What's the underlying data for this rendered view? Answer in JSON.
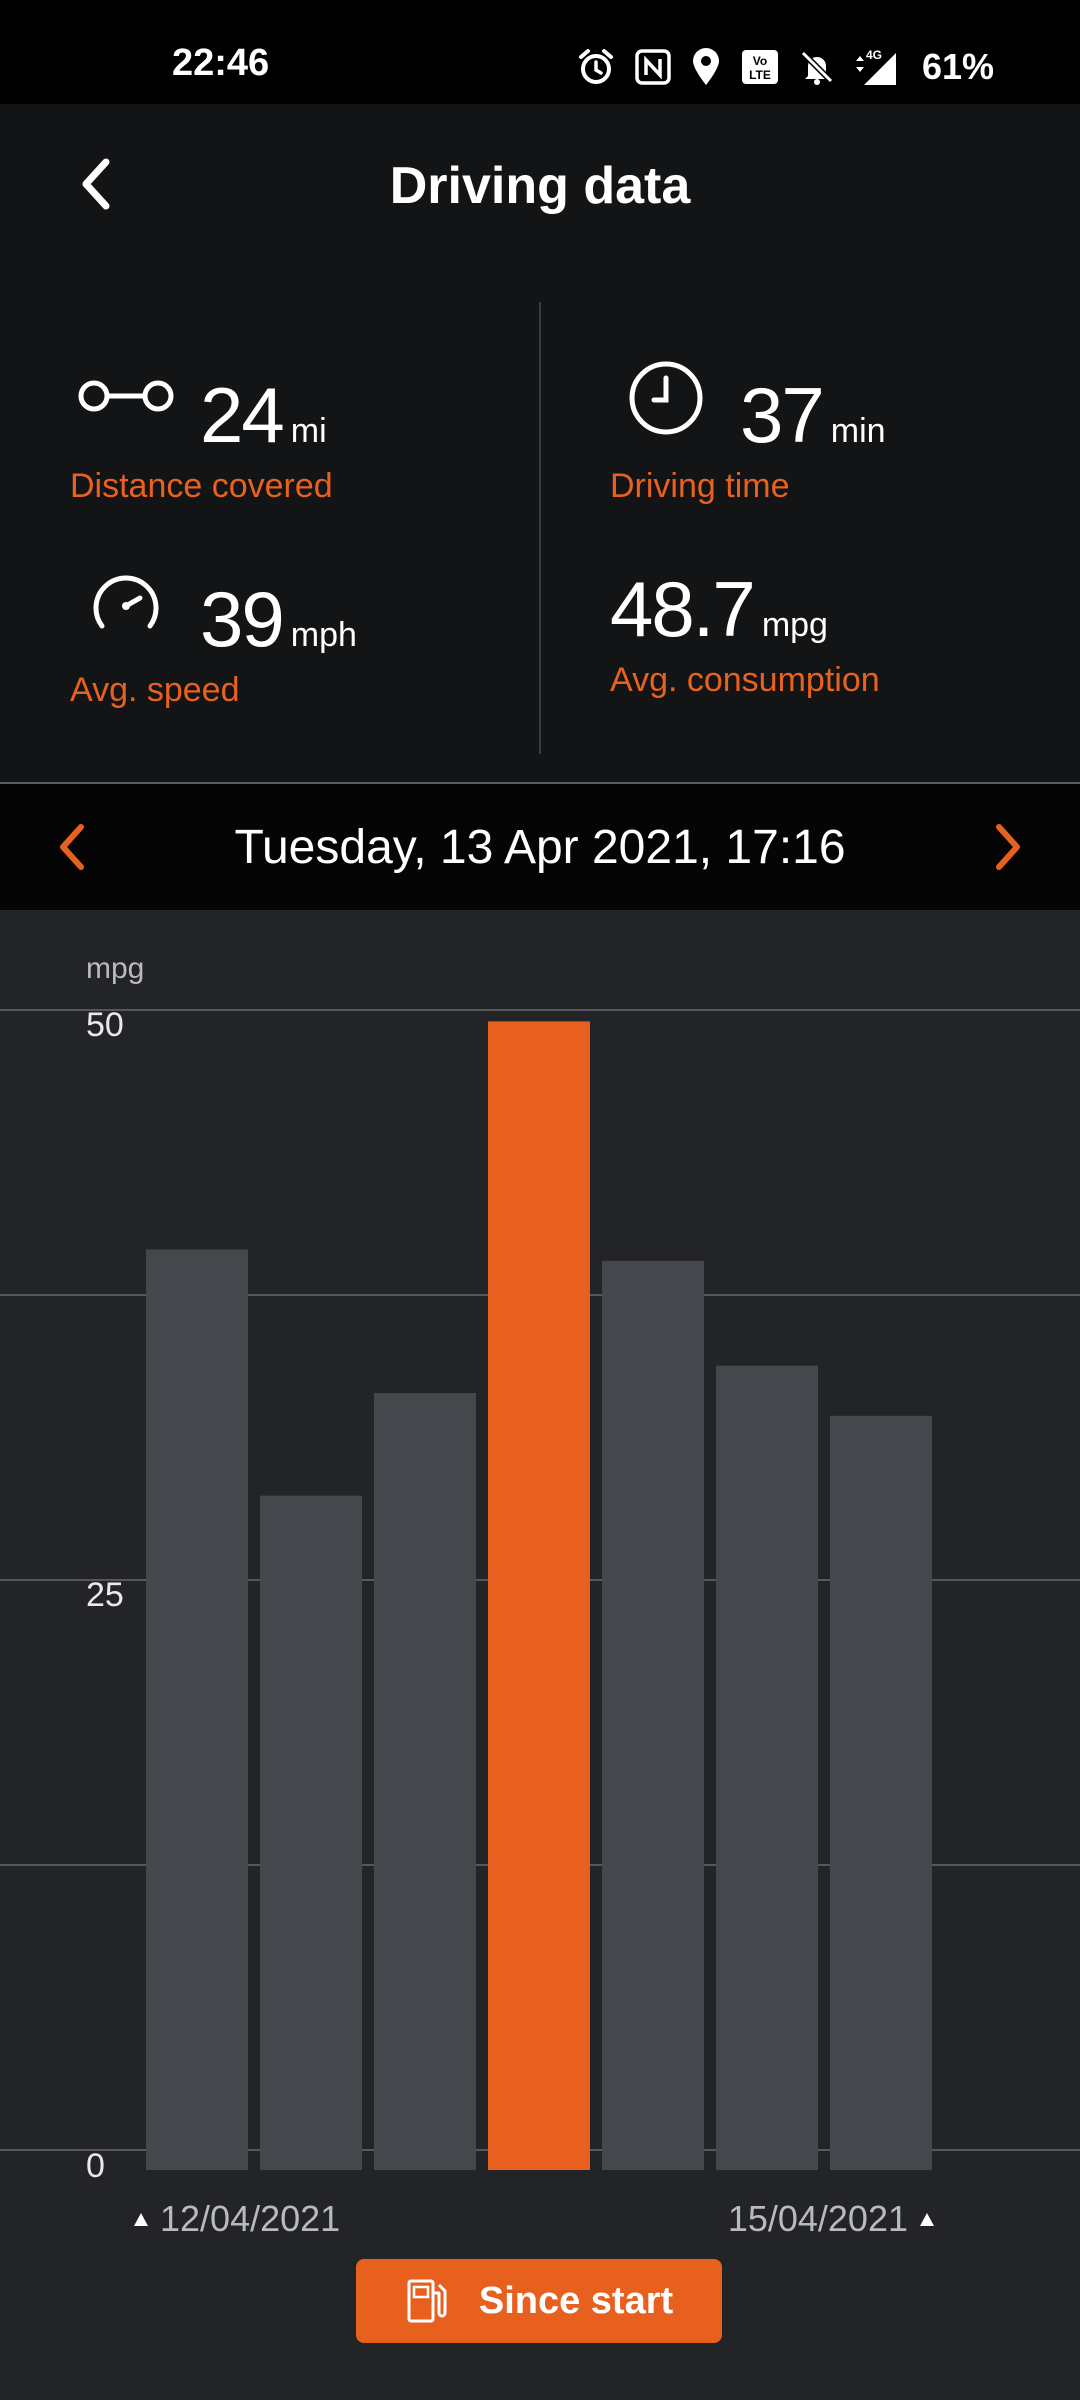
{
  "status_bar": {
    "time": "22:46",
    "battery": "61%",
    "icons": [
      "alarm-icon",
      "nfc-icon",
      "location-icon",
      "volte-icon",
      "bell-off-icon",
      "signal-4g-icon"
    ]
  },
  "header": {
    "title": "Driving data",
    "back_icon": "chevron-left-icon"
  },
  "stats": {
    "distance": {
      "value": "24",
      "unit": "mi",
      "label": "Distance covered",
      "icon": "distance-icon"
    },
    "driving_time": {
      "value": "37",
      "unit": "min",
      "label": "Driving time",
      "icon": "clock-icon"
    },
    "avg_speed": {
      "value": "39",
      "unit": "mph",
      "label": "Avg. speed",
      "icon": "speedometer-icon"
    },
    "avg_consumption": {
      "value": "48.7",
      "unit": "mpg",
      "label": "Avg. consumption"
    }
  },
  "date_nav": {
    "label": "Tuesday, 13 Apr 2021, 17:16",
    "prev_icon": "chevron-left-icon",
    "next_icon": "chevron-right-icon"
  },
  "chart": {
    "unit_label": "mpg",
    "start_date": "12/04/2021",
    "end_date": "15/04/2021"
  },
  "chart_data": {
    "type": "bar",
    "ylabel": "mpg",
    "ylim": [
      0,
      50
    ],
    "yticks": [
      "50",
      "25",
      "0"
    ],
    "values": [
      39.5,
      28.7,
      33.2,
      49.5,
      39.0,
      34.4,
      32.2
    ],
    "highlight_index": 3,
    "grid": true,
    "colors": {
      "bar": "#45474d",
      "highlight": "#e8601e",
      "grid": "#55575c"
    },
    "x_range_labels": [
      "12/04/2021",
      "15/04/2021"
    ]
  },
  "since_start_button": {
    "label": "Since start",
    "icon": "fuel-pump-icon",
    "color": "#e8601e"
  }
}
